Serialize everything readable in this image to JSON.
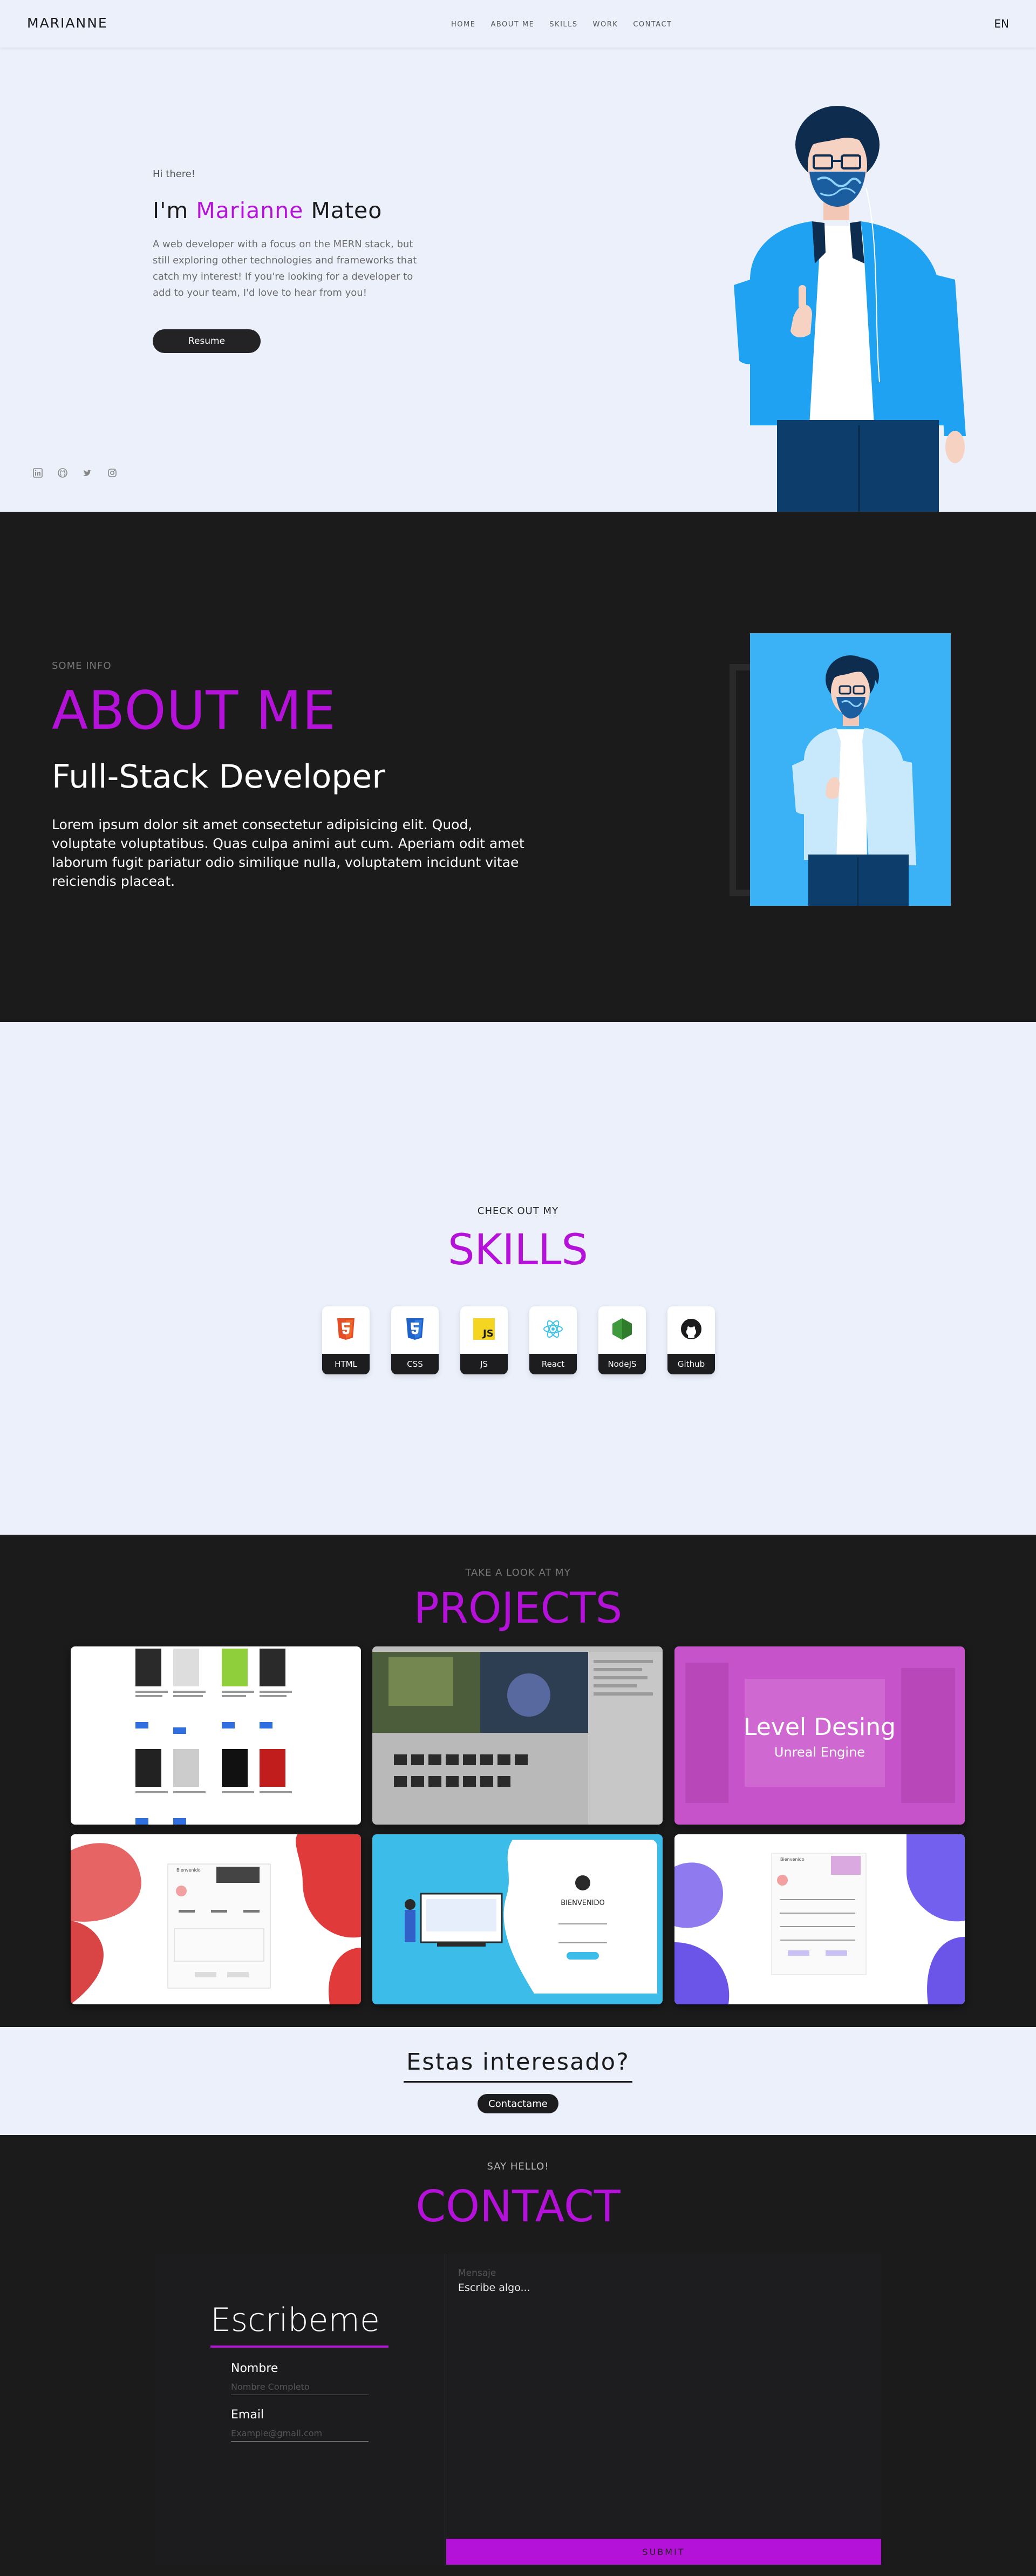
{
  "nav": {
    "brand": "MARIANNE",
    "links": [
      "HOME",
      "ABOUT ME",
      "SKILLS",
      "WORK",
      "CONTACT"
    ],
    "language": "EN"
  },
  "hero": {
    "greeting": "Hi there!",
    "name_prefix": "I'm ",
    "name_accent": "Marianne",
    "name_suffix": " Mateo",
    "description": "A web developer with a focus on the MERN stack, but still exploring other technologies and frameworks that catch my interest! If you're looking for a developer to add to your team, I'd love to hear from you!",
    "resume_label": "Resume",
    "social_icons": [
      "linkedin-icon",
      "github-icon",
      "twitter-icon",
      "instagram-icon"
    ]
  },
  "about": {
    "pre": "SOME INFO",
    "title": "ABOUT ME",
    "role": "Full-Stack Developer",
    "text": "Lorem ipsum dolor sit amet consectetur adipisicing elit. Quod, voluptate voluptatibus. Quas culpa animi aut cum. Aperiam odit amet laborum fugit pariatur odio similique nulla, voluptatem incidunt vitae reiciendis placeat."
  },
  "skills": {
    "pre": "CHECK OUT MY",
    "title": "SKILLS",
    "items": [
      {
        "label": "HTML",
        "icon": "html5-icon",
        "color": "#e44d26"
      },
      {
        "label": "CSS",
        "icon": "css3-icon",
        "color": "#2a6bd8"
      },
      {
        "label": "JS",
        "icon": "javascript-icon",
        "color": "#f4d622"
      },
      {
        "label": "React",
        "icon": "react-icon",
        "color": "#3fc4e8"
      },
      {
        "label": "NodeJS",
        "icon": "nodejs-icon",
        "color": "#3e9a3a"
      },
      {
        "label": "Github",
        "icon": "github-icon",
        "color": "#1b1b1d"
      }
    ]
  },
  "projects": {
    "pre": "TAKE A LOOK AT MY",
    "title": "PROJECTS",
    "items": [
      {
        "name": "project-bookstore"
      },
      {
        "name": "project-game-engine"
      },
      {
        "name": "project-level-design",
        "title": "Level Desing",
        "subtitle": "Unreal Engine"
      },
      {
        "name": "project-red-form",
        "heading": "Bienvenido"
      },
      {
        "name": "project-bienvenido",
        "heading": "BIENVENIDO"
      },
      {
        "name": "project-purple-form",
        "heading": "Bienvenido"
      }
    ]
  },
  "cta": {
    "question": "Estas interesado?",
    "button": "Contactame"
  },
  "contact": {
    "pre": "SAY HELLO!",
    "title": "CONTACT",
    "card_title": "Escribeme",
    "name_label": "Nombre",
    "name_placeholder": "Nombre Completo",
    "email_label": "Email",
    "email_placeholder": "Example@gmail.com",
    "message_label": "Mensaje",
    "message_placeholder": "Escribe algo...",
    "submit": "SUBMIT"
  },
  "colors": {
    "accent": "#b512d9",
    "dark": "#1b1b1c",
    "light": "#ecf0fb",
    "sky": "#3bb1f6"
  }
}
